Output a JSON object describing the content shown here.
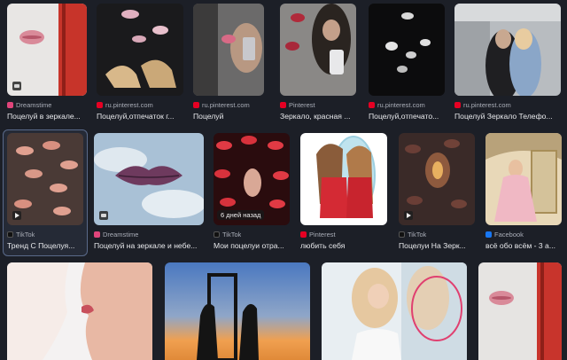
{
  "results": [
    {
      "source": "Dreamstime",
      "caption": "Поцелуй в зеркале..."
    },
    {
      "source": "ru.pinterest.com",
      "caption": "Поцелуй,отпечаток г..."
    },
    {
      "source": "ru.pinterest.com",
      "caption": "Поцелуй"
    },
    {
      "source": "Pinterest",
      "caption": "Зеркало, красная ..."
    },
    {
      "source": "ru.pinterest.com",
      "caption": "Поцелуй,отпечато..."
    },
    {
      "source": "ru.pinterest.com",
      "caption": "Поцелуй Зеркало Телефо..."
    },
    {
      "source": "TikTok",
      "caption": "Тренд С Поцелуя..."
    },
    {
      "source": "Dreamstime",
      "caption": "Поцелуй на зеркале и небе..."
    },
    {
      "source": "TikTok",
      "caption": "Мои поцелуи отра...",
      "date_badge": "6 дней назад"
    },
    {
      "source": "Pinterest",
      "caption": "любить себя"
    },
    {
      "source": "TikTok",
      "caption": "Поцелуи На Зерк..."
    },
    {
      "source": "Facebook",
      "caption": "всё обо всём - 3 а..."
    }
  ],
  "icons": {
    "image_badge": "image-icon",
    "video_badge": "play-icon"
  }
}
